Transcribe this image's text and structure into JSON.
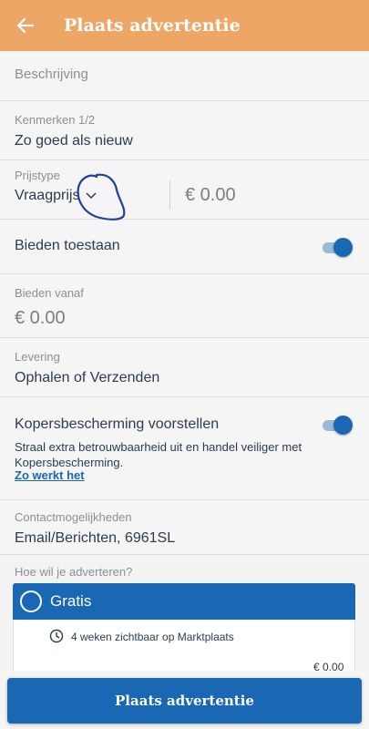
{
  "header": {
    "title": "Plaats advertentie",
    "back_icon": "arrow-left-icon"
  },
  "fields": {
    "description": {
      "label": "Beschrijving"
    },
    "features": {
      "label": "Kenmerken 1/2",
      "value": "Zo goed als nieuw"
    },
    "price_type": {
      "label": "Prijstype",
      "value": "Vraagprijs",
      "price": "€ 0.00"
    },
    "bidding": {
      "label": "Bieden toestaan",
      "enabled": true
    },
    "bid_from": {
      "label": "Bieden vanaf",
      "value": "€ 0.00"
    },
    "delivery": {
      "label": "Levering",
      "value": "Ophalen of Verzenden"
    },
    "buyer_protection": {
      "label": "Kopersbescherming voorstellen",
      "enabled": true,
      "description": "Straal extra betrouwbaarheid uit en handel veiliger met Kopersbescherming.",
      "link": "Zo werkt het"
    },
    "contact": {
      "label": "Contactmogelijkheden",
      "value": "Email/Berichten, 6961SL"
    }
  },
  "advertise": {
    "question": "Hoe wil je adverteren?",
    "option": {
      "label": "Gratis",
      "feature": "4 weken zichtbaar op Marktplaats",
      "price": "€ 0.00"
    }
  },
  "cta": {
    "label": "Plaats advertentie"
  },
  "colors": {
    "header": "#eea666",
    "accent": "#1a67b3",
    "text": "#2d3c4d",
    "annotation": "#1f3fa8"
  }
}
